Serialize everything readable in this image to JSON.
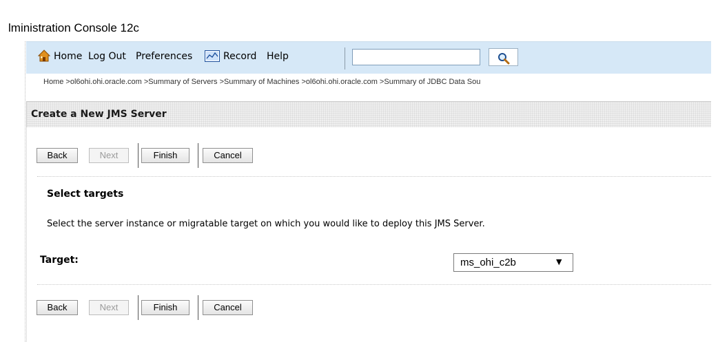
{
  "window": {
    "title": "lministration Console 12c"
  },
  "toolbar": {
    "home": "Home",
    "logout": "Log Out",
    "preferences": "Preferences",
    "record": "Record",
    "help": "Help",
    "search_value": "",
    "icons": {
      "home": "home-icon",
      "record": "record-icon",
      "search": "search-icon"
    }
  },
  "breadcrumb": {
    "items": [
      "Home",
      "ol6ohi.ohi.oracle.com",
      "Summary of Servers",
      "Summary of Machines",
      "ol6ohi.ohi.oracle.com",
      "Summary of JDBC Data Sou"
    ],
    "separator": " >"
  },
  "panel": {
    "title": "Create a New JMS Server"
  },
  "buttons": {
    "back": "Back",
    "next": "Next",
    "finish": "Finish",
    "cancel": "Cancel"
  },
  "content": {
    "section_title": "Select targets",
    "description": "Select the server instance or migratable target on which you would like to deploy this JMS Server.",
    "target_label": "Target:",
    "target_value": "ms_ohi_c2b",
    "dropdown_arrow": "▼"
  },
  "colors": {
    "toolbar_bg": "#d6e8f7",
    "header_bg": "#f0f0f0",
    "disabled_text": "#9a9a9a"
  }
}
